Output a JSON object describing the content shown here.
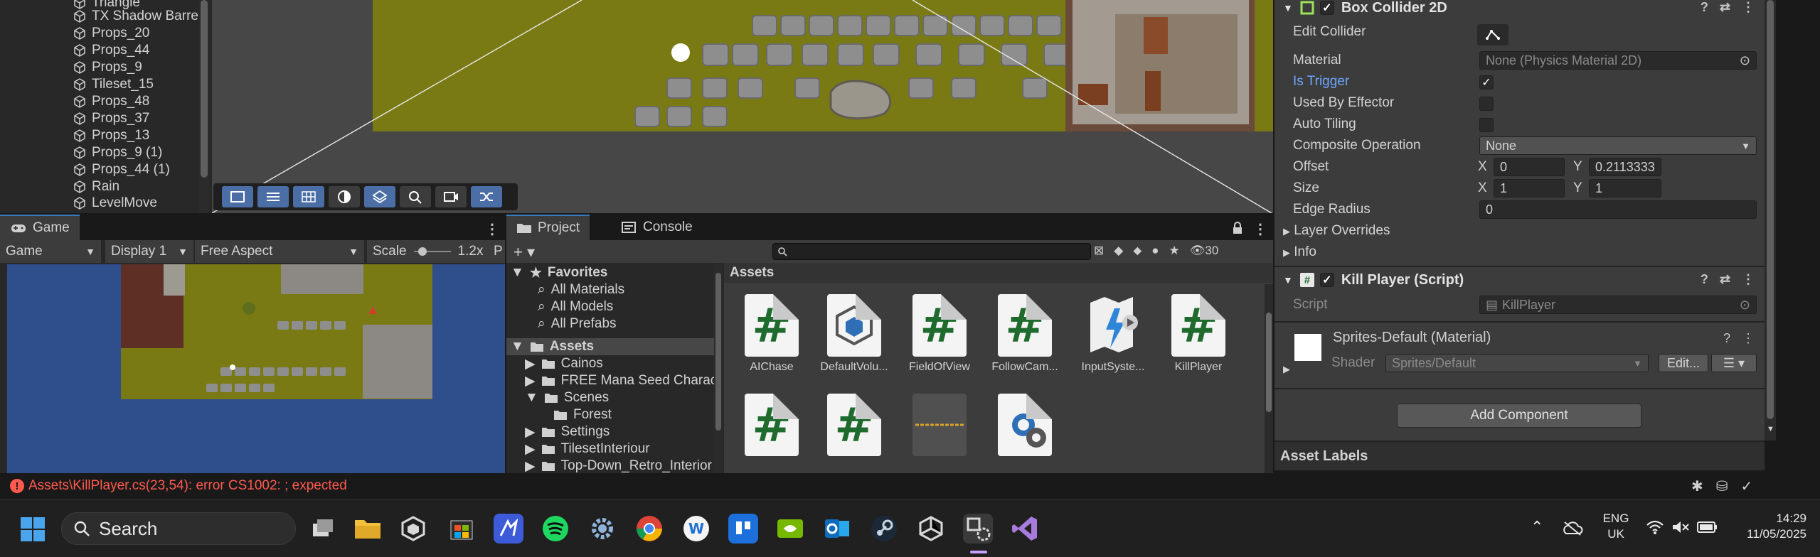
{
  "hierarchy": {
    "items": [
      "Triangle",
      "TX Shadow Barre",
      "Props_20",
      "Props_44",
      "Props_9",
      "Tileset_15",
      "Props_48",
      "Props_37",
      "Props_13",
      "Props_9 (1)",
      "Props_44 (1)",
      "Rain",
      "LevelMove"
    ]
  },
  "game": {
    "tab_label": "Game",
    "mode": "Game",
    "display": "Display 1",
    "aspect": "Free Aspect",
    "scale_label": "Scale",
    "scale_value": "1.2x",
    "trailing": "P"
  },
  "project": {
    "tab_label": "Project",
    "console_label": "Console",
    "hidden_count": "30",
    "tree": {
      "favorites": "Favorites",
      "fav_items": [
        "All Materials",
        "All Models",
        "All Prefabs"
      ],
      "assets": "Assets",
      "folders": [
        "Cainos",
        "FREE Mana Seed Charact",
        "Scenes",
        "Forest",
        "Settings",
        "TilesetInteriour",
        "Top-Down_Retro_Interior"
      ]
    },
    "breadcrumb": "Assets",
    "assets": [
      "AIChase",
      "DefaultVolu...",
      "FieldOfView",
      "FollowCam...",
      "InputSyste...",
      "KillPlayer"
    ]
  },
  "inspector": {
    "box_collider": {
      "title": "Box Collider 2D",
      "edit_collider": "Edit Collider",
      "material_label": "Material",
      "material_value": "None (Physics Material 2D)",
      "is_trigger": "Is Trigger",
      "used_by_effector": "Used By Effector",
      "auto_tiling": "Auto Tiling",
      "composite_operation": "Composite Operation",
      "composite_value": "None",
      "offset_label": "Offset",
      "offset_x": "0",
      "offset_y": "0.2113333",
      "size_label": "Size",
      "size_x": "1",
      "size_y": "1",
      "edge_radius_label": "Edge Radius",
      "edge_radius": "0",
      "layer_overrides": "Layer Overrides",
      "info": "Info",
      "x": "X",
      "y": "Y"
    },
    "kill_player": {
      "title": "Kill Player (Script)",
      "script_label": "Script",
      "script_value": "KillPlayer"
    },
    "material": {
      "title": "Sprites-Default (Material)",
      "shader_label": "Shader",
      "shader_value": "Sprites/Default",
      "edit_button": "Edit..."
    },
    "add_component": "Add Component",
    "asset_labels": "Asset Labels"
  },
  "status": {
    "error": "Assets\\KillPlayer.cs(23,54): error CS1002: ; expected"
  },
  "taskbar": {
    "search": "Search",
    "lang1": "ENG",
    "lang2": "UK",
    "time": "14:29",
    "date": "11/05/2025"
  },
  "colors": {
    "accent": "#3a79bb",
    "error": "#ff5a4f",
    "grass": "#7a7a14",
    "water": "#2f4e8c",
    "csharp_green": "#1f6b2e"
  }
}
